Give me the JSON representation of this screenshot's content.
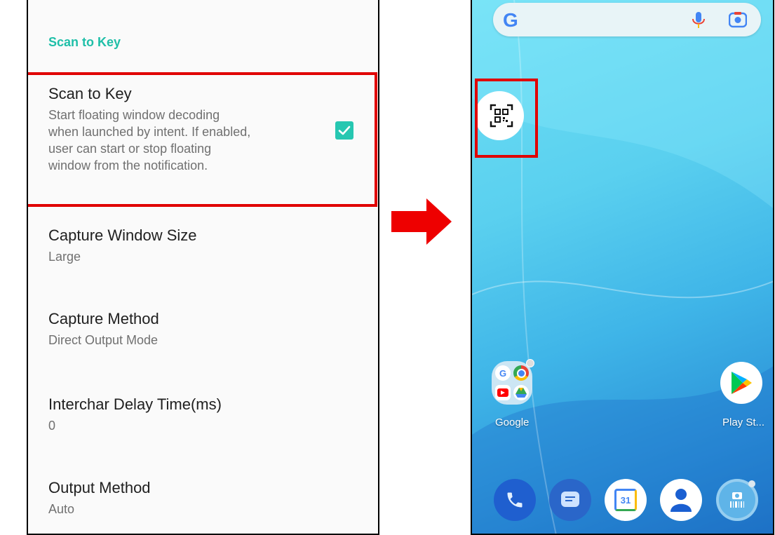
{
  "settings": {
    "section_header": "Scan to Key",
    "scan_to_key": {
      "title": "Scan to Key",
      "summary_lines": [
        "Start floating window decoding",
        "when launched by intent. If enabled,",
        "user can start or stop floating",
        "window from the notification."
      ],
      "checked": true
    },
    "capture_window_size": {
      "title": "Capture Window Size",
      "value": "Large"
    },
    "capture_method": {
      "title": "Capture Method",
      "value": "Direct Output Mode"
    },
    "interchar_delay": {
      "title": "Interchar Delay Time(ms)",
      "value": "0"
    },
    "output_method": {
      "title": "Output Method",
      "value": "Auto"
    }
  },
  "home": {
    "search_logo": "G",
    "folder_label": "Google",
    "playstore_label": "Play St...",
    "calendar_day": "31",
    "icons": [
      "google-g-icon",
      "mic-icon",
      "lens-icon",
      "qr-scan-icon",
      "phone-icon",
      "messages-icon",
      "calendar-icon",
      "contacts-icon",
      "scanner-app-icon",
      "play-store-icon"
    ]
  },
  "colors": {
    "accent": "#1fbfa8",
    "checkbox": "#26c7b1",
    "highlight": "#e00000",
    "arrow": "#ee0000"
  }
}
